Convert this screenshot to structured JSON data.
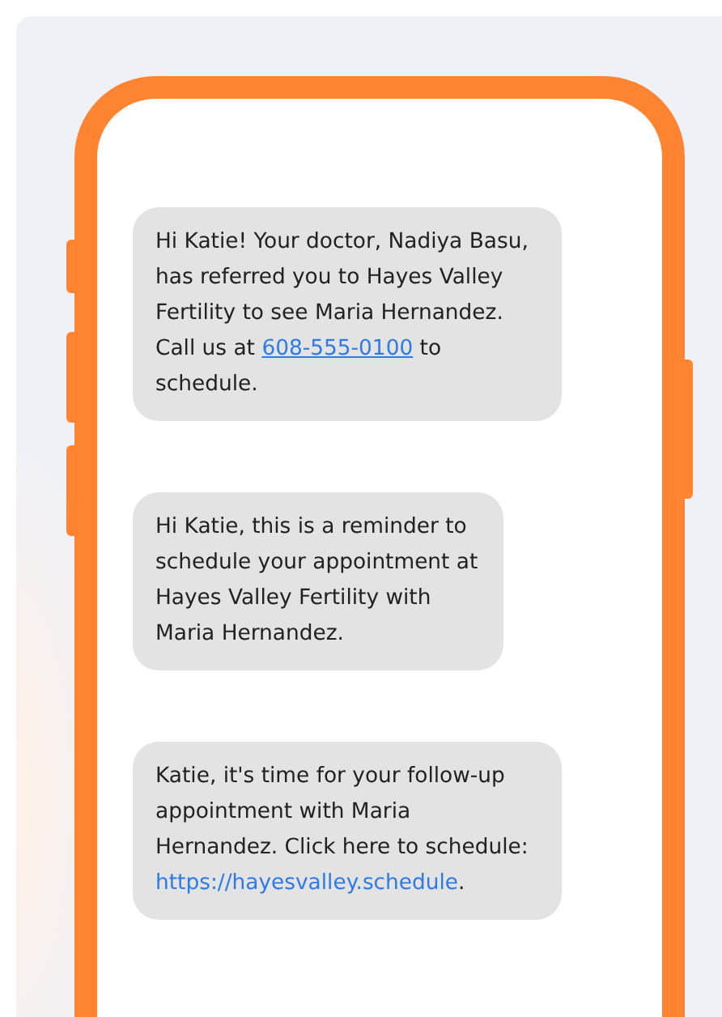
{
  "messages": [
    {
      "segments": [
        {
          "kind": "text",
          "text": "Hi Katie! Your doctor, Nadiya Basu, has referred you to Hayes Valley Fertility to see Maria Hernandez. Call us at "
        },
        {
          "kind": "link",
          "text": "608-555-0100",
          "underlined": true
        },
        {
          "kind": "text",
          "text": " to schedule."
        }
      ]
    },
    {
      "segments": [
        {
          "kind": "text",
          "text": "Hi Katie, this is a reminder to schedule your appointment at Hayes Valley Fertility with Maria Hernandez."
        }
      ]
    },
    {
      "segments": [
        {
          "kind": "text",
          "text": "Katie, it's time for your follow-up appointment with Maria Hernandez. Click here to schedule: "
        },
        {
          "kind": "link",
          "text": "https://hayesvalley.schedule",
          "underlined": false
        },
        {
          "kind": "text",
          "text": "."
        }
      ]
    }
  ]
}
